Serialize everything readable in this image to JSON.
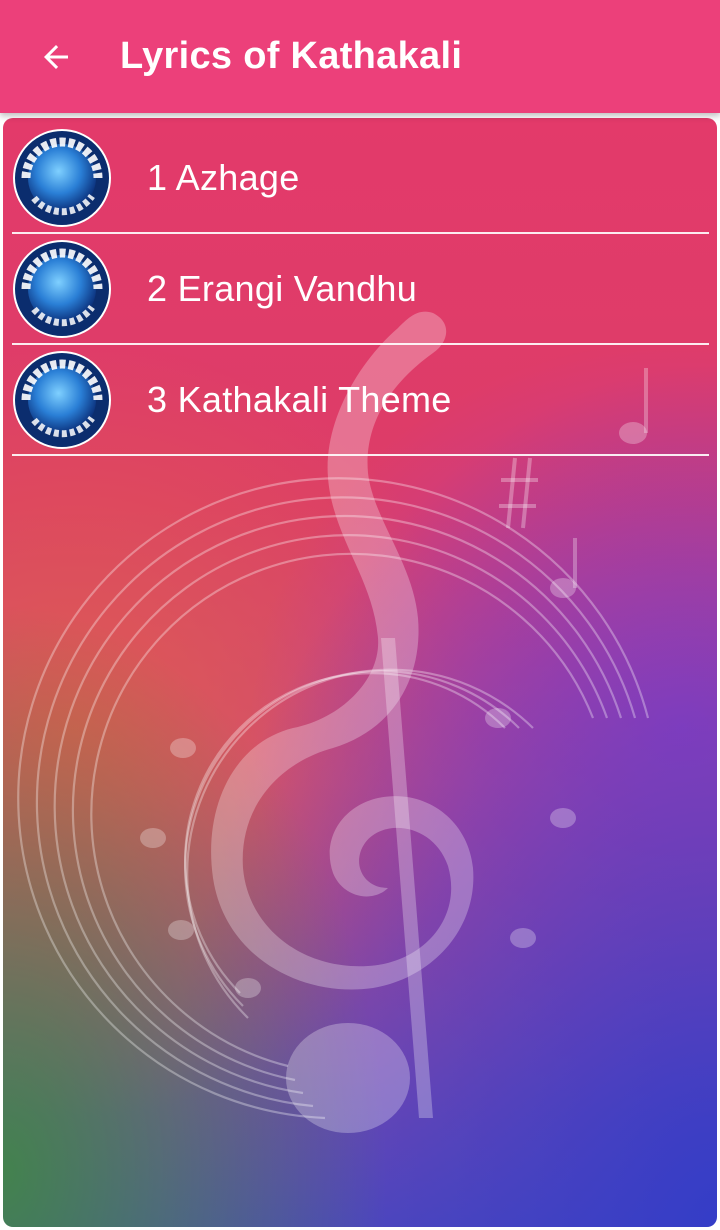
{
  "toolbar": {
    "title": "Lyrics of Kathakali",
    "back_icon": "arrow-left-icon",
    "background": "#ec407a"
  },
  "songs": [
    {
      "label": "1 Azhage"
    },
    {
      "label": "2 Erangi Vandhu"
    },
    {
      "label": "3 Kathakali Theme"
    }
  ],
  "badge": {
    "text": "KATHAKALI SONGS LYRICS",
    "icon": "kathakali-songs-lyrics-logo"
  },
  "background_art": "treble-clef-music-notes"
}
